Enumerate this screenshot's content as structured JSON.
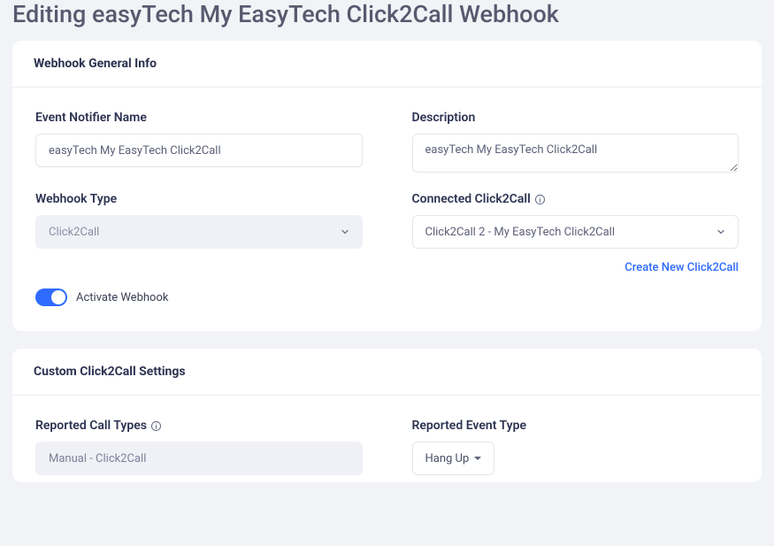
{
  "page_title": "Editing easyTech My EasyTech Click2Call Webhook",
  "general": {
    "header": "Webhook General Info",
    "event_notifier_label": "Event Notifier Name",
    "event_notifier_value": "easyTech My EasyTech Click2Call",
    "description_label": "Description",
    "description_value": "easyTech My EasyTech Click2Call",
    "webhook_type_label": "Webhook Type",
    "webhook_type_value": "Click2Call",
    "connected_label": "Connected Click2Call",
    "connected_value": "Click2Call 2 - My EasyTech Click2Call",
    "create_link": "Create New Click2Call",
    "activate_label": "Activate Webhook"
  },
  "settings": {
    "header": "Custom Click2Call Settings",
    "reported_call_types_label": "Reported Call Types",
    "reported_call_types_value": "Manual - Click2Call",
    "reported_event_type_label": "Reported Event Type",
    "reported_event_type_value": "Hang Up"
  }
}
